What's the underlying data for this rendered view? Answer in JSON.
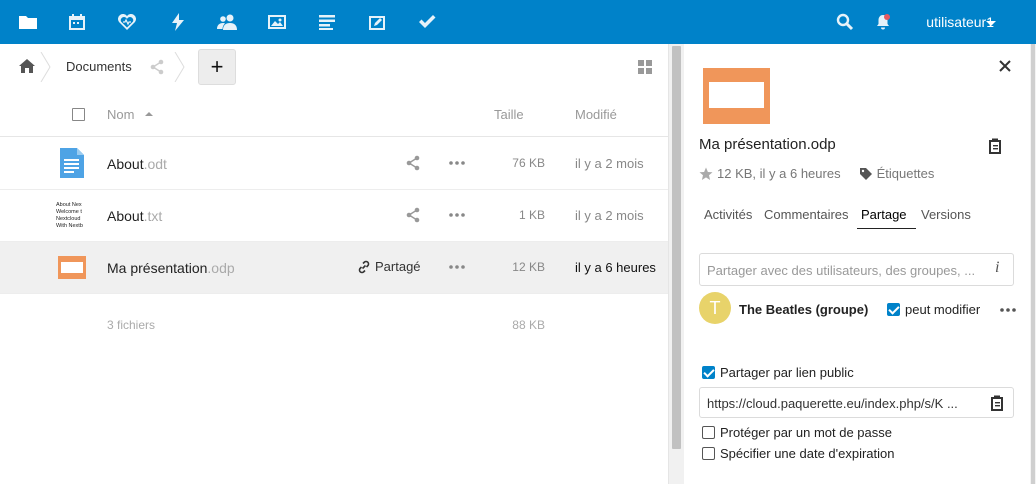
{
  "topbar": {
    "apps": [
      "files-icon",
      "calendar-icon",
      "health-icon",
      "activity-icon",
      "contacts-icon",
      "gallery-icon",
      "notes-icon",
      "deck-icon",
      "tasks-icon"
    ],
    "user": "utilisateur1",
    "colors": {
      "bar": "#0082c9"
    }
  },
  "breadcrumb": {
    "folder": "Documents",
    "add_label": "+"
  },
  "table": {
    "headers": {
      "name": "Nom",
      "size": "Taille",
      "modified": "Modifié"
    },
    "rows": [
      {
        "base": "About",
        "ext": ".odt",
        "size": "76 KB",
        "modified": "il y a 2 mois",
        "icon": "document-icon"
      },
      {
        "base": "About",
        "ext": ".txt",
        "size": "1 KB",
        "modified": "il y a 2 mois",
        "icon": "text-preview-icon",
        "preview": [
          "About Nex",
          "Welcome t",
          "Nextcloud",
          "With Nextb"
        ]
      },
      {
        "base": "Ma présentation",
        "ext": ".odp",
        "size": "12 KB",
        "modified": "il y a 6 heures",
        "icon": "presentation-icon",
        "shared": "Partagé"
      }
    ],
    "summary": {
      "count": "3 fichiers",
      "total": "88 KB"
    }
  },
  "sidebar": {
    "title": "Ma présentation.odp",
    "meta": "12 KB, il y a 6 heures",
    "tags": "Étiquettes",
    "tabs": [
      "Activités",
      "Commentaires",
      "Partage",
      "Versions"
    ],
    "active_tab": "Partage",
    "share_placeholder": "Partager avec des utilisateurs, des groupes, ...",
    "share_info": "i",
    "sharee": {
      "initial": "T",
      "name": "The Beatles (groupe)",
      "permission": "peut modifier",
      "avatar_color": "#e8d36a"
    },
    "public_link_label": "Partager par lien public",
    "public_link": "https://cloud.paquerette.eu/index.php/s/K ...",
    "password_label": "Protéger par un mot de passe",
    "expiry_label": "Spécifier une date d'expiration"
  }
}
